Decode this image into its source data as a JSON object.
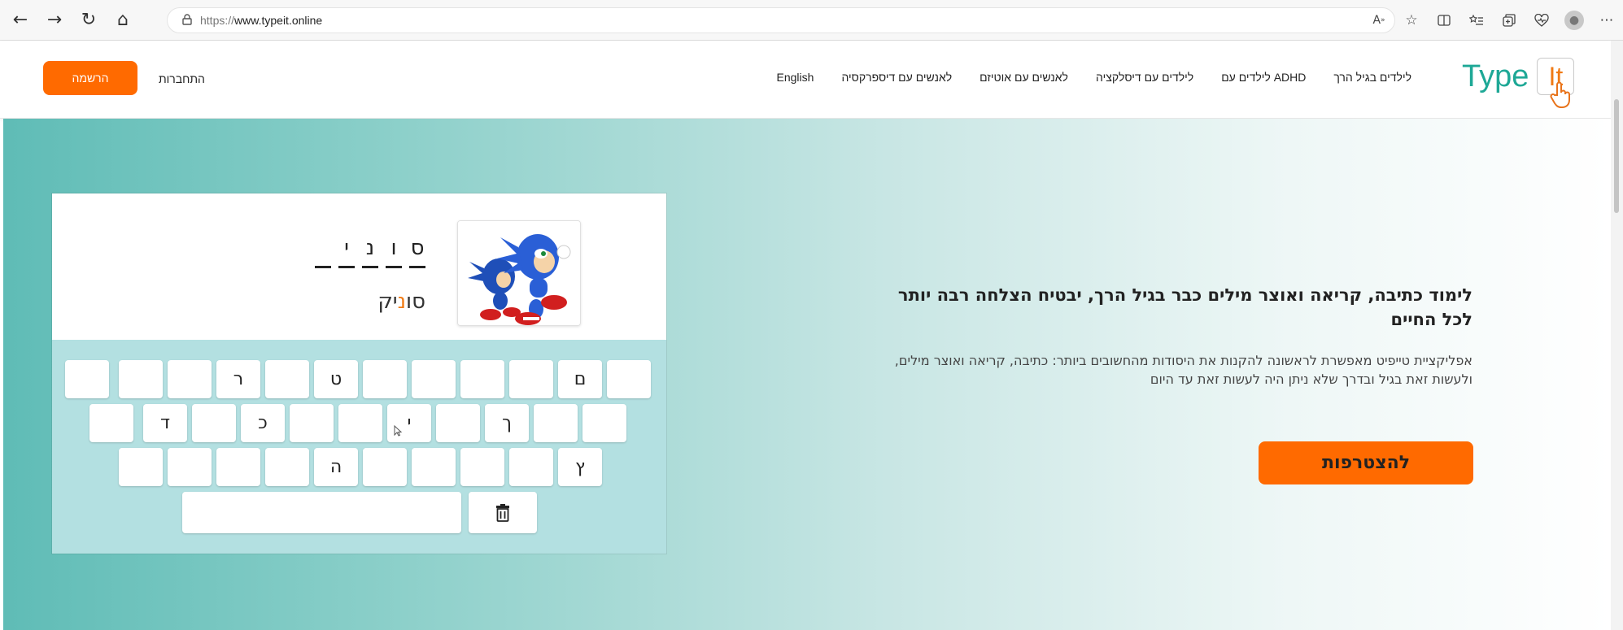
{
  "browser": {
    "url_prefix": "https://",
    "url_domain": "www.typeit.online",
    "back": "←",
    "forward": "→",
    "refresh": "↻",
    "home": "⌂",
    "more": "⋯"
  },
  "header": {
    "logo_type": "Type",
    "logo_it": "It",
    "nav": [
      "לילדים בגיל הרך",
      "לילדים עם ADHD",
      "לילדים עם דיסלקציה",
      "לאנשים עם אוטיזם",
      "לאנשים עם דיספרקסיה",
      "English"
    ],
    "login": "התחברות",
    "signup": "הרשמה"
  },
  "demo": {
    "word_slots": [
      "ס",
      "ו",
      "נ",
      "י",
      ""
    ],
    "hint_before": "סו",
    "hint_highlight": "נ",
    "hint_after": "יק",
    "keys_row1": [
      "ם",
      "",
      "",
      "",
      "",
      "ט",
      "",
      "ר",
      "",
      "",
      ""
    ],
    "keys_row2": [
      "",
      "",
      "ך",
      "",
      "י",
      "",
      "",
      "כ",
      "",
      "ד",
      ""
    ],
    "keys_row3": [
      "ץ",
      "",
      "",
      "",
      "ה",
      "",
      "",
      "",
      ""
    ]
  },
  "hero": {
    "headline": "לימוד כתיבה, קריאה ואוצר מילים כבר בגיל הרך, יבטיח הצלחה רבה יותר לכל החיים",
    "subtext": "אפליקציית טייפיט מאפשרת לראשונה להקנות את היסודות מהחשובים ביותר: כתיבה, קריאה ואוצר מילים, ולעשות זאת בגיל ובדרך שלא ניתן היה לעשות זאת עד היום",
    "cta": "להצטרפות"
  },
  "colors": {
    "brand_teal": "#1ea896",
    "brand_orange": "#ff6a00",
    "keyboard_bg": "#b3e0e1"
  }
}
